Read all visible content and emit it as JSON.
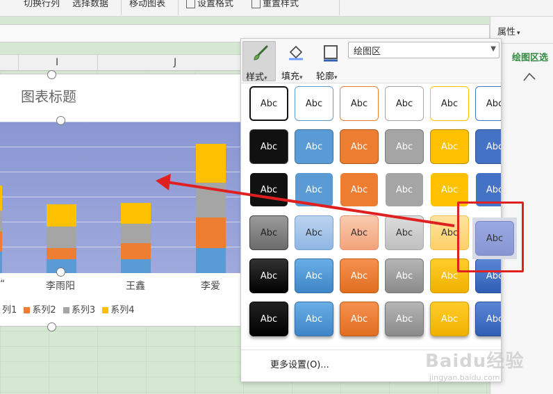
{
  "ribbon": {
    "items": [
      "切换行列",
      "选择数据",
      "移动图表",
      "设置格式",
      "重置样式"
    ]
  },
  "sheet": {
    "columns": [
      "I",
      "J"
    ]
  },
  "pane": {
    "title": "属性",
    "title_caret": "▾",
    "tab": "绘图区选"
  },
  "chart": {
    "title": "图表标题",
    "categories_visible": [
      "李雨阳",
      "王鑫",
      "李爱"
    ],
    "cut_left_label": "“",
    "legend": [
      {
        "name": "列1",
        "color": "#5b9bd5"
      },
      {
        "name": "系列2",
        "color": "#ed7d31"
      },
      {
        "name": "系列3",
        "color": "#a5a5a5"
      },
      {
        "name": "系列4",
        "color": "#ffc000"
      }
    ]
  },
  "panel": {
    "tabs": [
      {
        "label": "样式",
        "caret": "▾",
        "icon": "brush-icon",
        "selected": true
      },
      {
        "label": "填充",
        "caret": "▾",
        "icon": "fill-bucket-icon",
        "selected": false
      },
      {
        "label": "轮廓",
        "caret": "▾",
        "icon": "outline-icon",
        "selected": false
      }
    ],
    "area_select": "绘图区",
    "swatch_text": "Abc",
    "more_settings": "更多设置(O)...",
    "selected_swatch": "row4-col6",
    "highlight_color": "#e02020",
    "arrow_color": "#e02020"
  },
  "watermark": {
    "brand": "Baidu经验",
    "url": "jingyan.baidu.com"
  }
}
